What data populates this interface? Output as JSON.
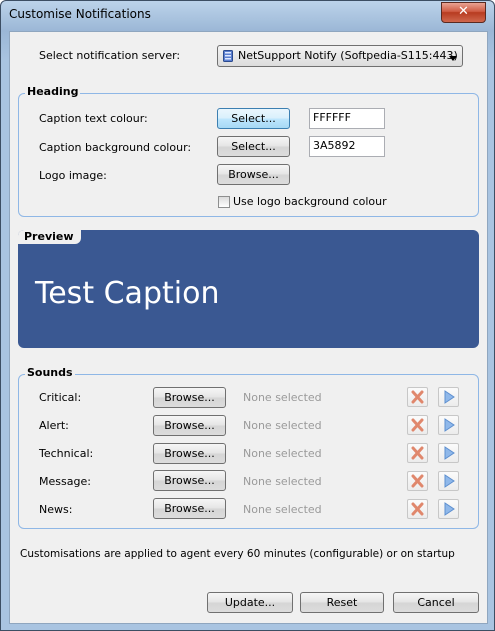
{
  "window": {
    "title": "Customise Notifications",
    "close_label": "✕"
  },
  "server": {
    "label": "Select notification server:",
    "value": "NetSupport Notify (Softpedia-S115:443)"
  },
  "heading": {
    "group_label": "Heading",
    "caption_text_label": "Caption text colour:",
    "caption_text_button": "Select...",
    "caption_text_value": "FFFFFF",
    "caption_bg_label": "Caption background colour:",
    "caption_bg_button": "Select...",
    "caption_bg_value": "3A5892",
    "logo_label": "Logo image:",
    "logo_button": "Browse...",
    "use_logo_bg_label": "Use logo background colour",
    "use_logo_bg_checked": false
  },
  "preview": {
    "group_label": "Preview",
    "caption": "Test Caption",
    "bg_color": "#3A5892",
    "text_color": "#FFFFFF"
  },
  "sounds": {
    "group_label": "Sounds",
    "items": [
      {
        "label": "Critical:",
        "button": "Browse...",
        "status": "None selected"
      },
      {
        "label": "Alert:",
        "button": "Browse...",
        "status": "None selected"
      },
      {
        "label": "Technical:",
        "button": "Browse...",
        "status": "None selected"
      },
      {
        "label": "Message:",
        "button": "Browse...",
        "status": "None selected"
      },
      {
        "label": "News:",
        "button": "Browse...",
        "status": "None selected"
      }
    ]
  },
  "footer": {
    "note": "Customisations are applied to agent every 60 minutes (configurable) or on startup",
    "update_button": "Update...",
    "reset_button": "Reset",
    "cancel_button": "Cancel"
  }
}
